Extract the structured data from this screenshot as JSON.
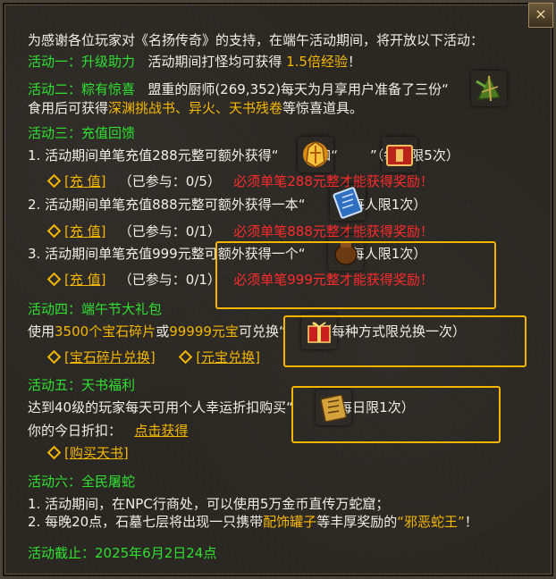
{
  "panel": {
    "close_label": "×",
    "intro": "为感谢各位玩家对《名扬传奇》的支持，在端午活动期间，将开放以下活动：",
    "a1": {
      "title": "活动一：升级助力",
      "text_a": "活动期间打怪均可获得",
      "bonus": "1.5倍经验",
      "text_b": "！"
    },
    "a2": {
      "title": "活动二：粽有惊喜",
      "text_a": "盟重的厨师(269,352)每天为月享用户准备了三份“",
      "text_b": "”",
      "line2_a": "食用后可获得",
      "rewards": "深渊挑战书、异火、天书残卷",
      "line2_b": "等惊喜道具。"
    },
    "a3": {
      "title": "活动三：充值回馈",
      "tiers": [
        {
          "text_a": "1. 活动期间单笔充值288元整可额外获得“",
          "mid": "”和“",
          "text_b": "”（每人限5次）",
          "button": "[充 值]",
          "status": "（已参与：0/5）",
          "warn": "必须单笔288元整才能获得奖励！"
        },
        {
          "text_a": "2. 活动期间单笔充值888元整可额外获得一本“",
          "text_b": "”（每人限1次）",
          "button": "[充 值]",
          "status": "（已参与：0/1）",
          "warn": "必须单笔888元整才能获得奖励！"
        },
        {
          "text_a": "3. 活动期间单笔充值999元整可额外获得一个“",
          "text_b": "”（每人限1次）",
          "button": "[充 值]",
          "status": "（已参与：0/1）",
          "warn": "必须单笔999元整才能获得奖励！"
        }
      ]
    },
    "a4": {
      "title": "活动四：端午节大礼包",
      "text_a": "使用",
      "shards": "3500个宝石碎片",
      "or": "或",
      "yuanbao": "99999元宝",
      "text_b": "可兑换“",
      "text_c": "”（每种方式限兑换一次）",
      "btn1": "[宝石碎片兑换]",
      "btn2": "[元宝兑换]"
    },
    "a5": {
      "title": "活动五：天书福利",
      "text_a": "达到40级的玩家每天可用个人幸运折扣购买“",
      "text_b": "”（每日限1次）",
      "discount_label": "你的今日折扣：",
      "discount_link": "点击获得",
      "buy_button": "[购买天书]"
    },
    "a6": {
      "title": "活动六：全民屠蛇",
      "line1": "1. 活动期间，在NPC行商处，可以使用5万金币直传万蛇窟；",
      "line2_a": "2. 每晚20点，石墓七层将出现一只携带",
      "item": "配饰罐子",
      "line2_b": "等丰厚奖励的",
      "boss": "“邪恶蛇王”",
      "line2_c": "！"
    },
    "deadline": "活动截止：2025年6月2日24点"
  },
  "colors": {
    "green": "#2fe02f",
    "gold": "#f5b700",
    "red": "#ff2b2b",
    "text": "#f2efe6",
    "highlight": "#f2b600"
  },
  "icons": [
    "zongzi-icon",
    "golden-armor-icon",
    "red-book-icon",
    "blue-book-icon",
    "clay-jar-icon",
    "gift-box-icon",
    "skill-book-icon"
  ]
}
